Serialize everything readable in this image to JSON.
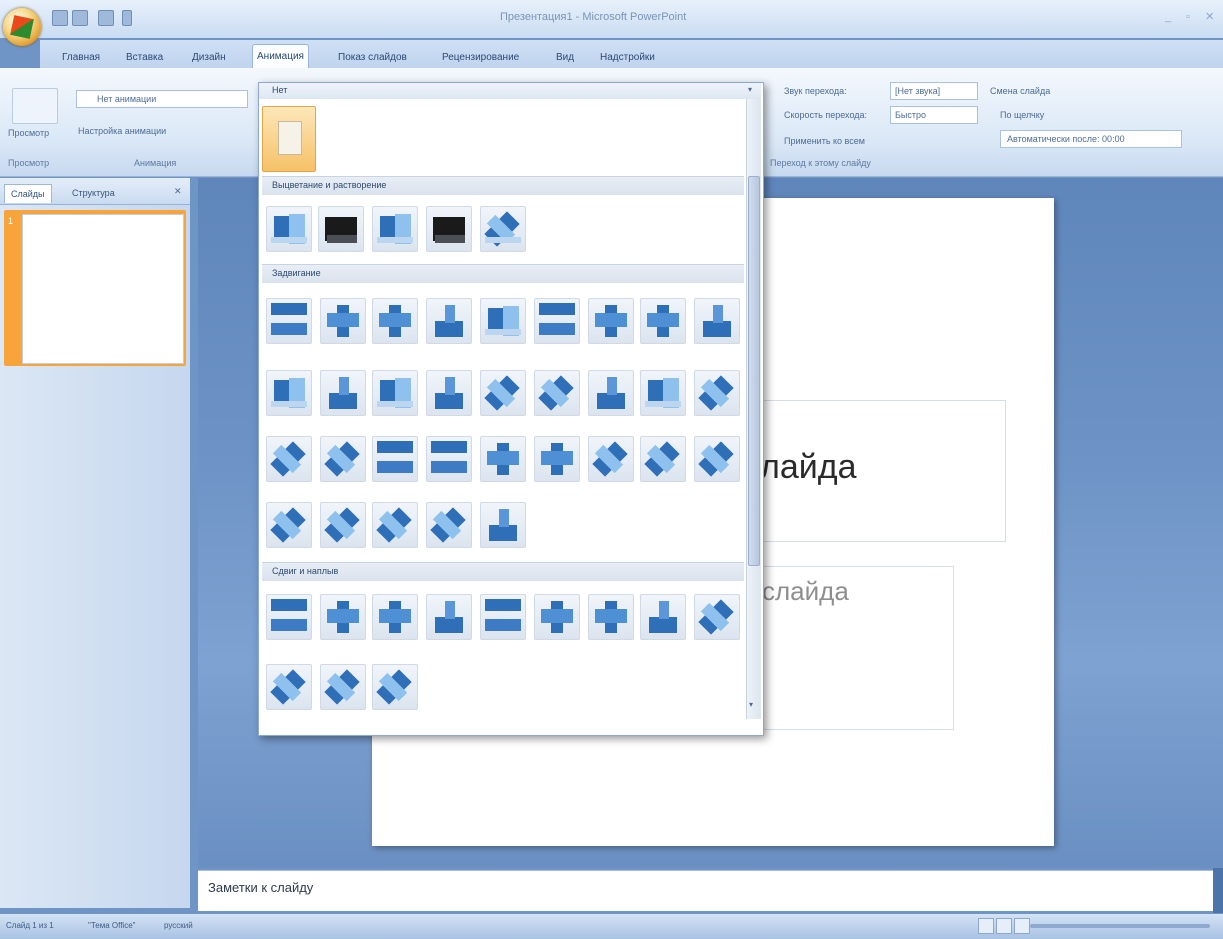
{
  "window": {
    "title": "Презентация1 - Microsoft PowerPoint",
    "controls": "_ ▫ ✕"
  },
  "ribbon": {
    "tabs": [
      "Главная",
      "Вставка",
      "Дизайн",
      "Анимация",
      "Показ слайдов",
      "Рецензирование",
      "Вид",
      "Надстройки"
    ],
    "active_tab": "Анимация",
    "preview_label": "Просмотр",
    "animations_group": "Анимация",
    "animation_combo": "Нет анимации",
    "custom_anim_button": "Настройка анимации",
    "sound_label": "Звук перехода:",
    "sound_value": "[Нет звука]",
    "speed_label": "Скорость перехода:",
    "speed_value": "Быстро",
    "apply_all": "Применить ко всем",
    "advance_label": "Смена слайда",
    "on_click": "По щелчку",
    "auto_after": "Автоматически после: 00:00",
    "transition_group": "Переход к этому слайду"
  },
  "gallery": {
    "header": "Нет",
    "sections": [
      "Выцветание и растворение",
      "Задвигание",
      "Сдвиг и наплыв"
    ]
  },
  "left_pane": {
    "tabs": [
      "Слайды",
      "Структура"
    ],
    "close": "✕",
    "slide_number": "1"
  },
  "slide": {
    "title_placeholder": "лайда",
    "subtitle_placeholder": "слайда"
  },
  "notes": {
    "placeholder": "Заметки к слайду"
  },
  "status": {
    "slide": "Слайд 1 из 1",
    "theme": "\"Тема Office\"",
    "language": "русский"
  }
}
